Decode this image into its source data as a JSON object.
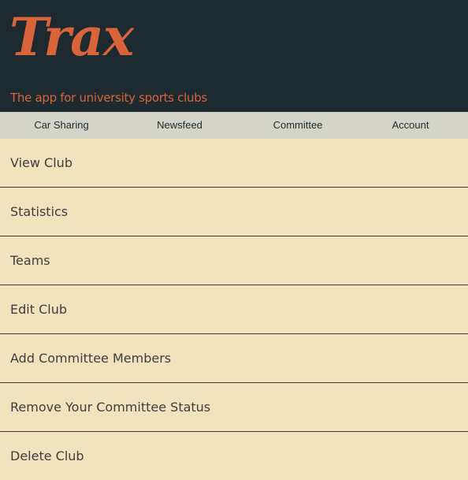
{
  "header": {
    "logo_text": "Trax",
    "tagline": "The app for university sports clubs",
    "background_color": "#1d2a30",
    "accent_color": "#d9643a"
  },
  "nav": {
    "items": [
      {
        "label": "Car Sharing"
      },
      {
        "label": "Newsfeed"
      },
      {
        "label": "Committee"
      },
      {
        "label": "Account"
      }
    ],
    "background_color": "#d5d4c8"
  },
  "menu": {
    "items": [
      {
        "label": "View Club"
      },
      {
        "label": "Statistics"
      },
      {
        "label": "Teams"
      },
      {
        "label": "Edit Club"
      },
      {
        "label": "Add Committee Members"
      },
      {
        "label": "Remove Your Committee Status"
      },
      {
        "label": "Delete Club"
      }
    ],
    "background_color": "#f2e2be"
  }
}
